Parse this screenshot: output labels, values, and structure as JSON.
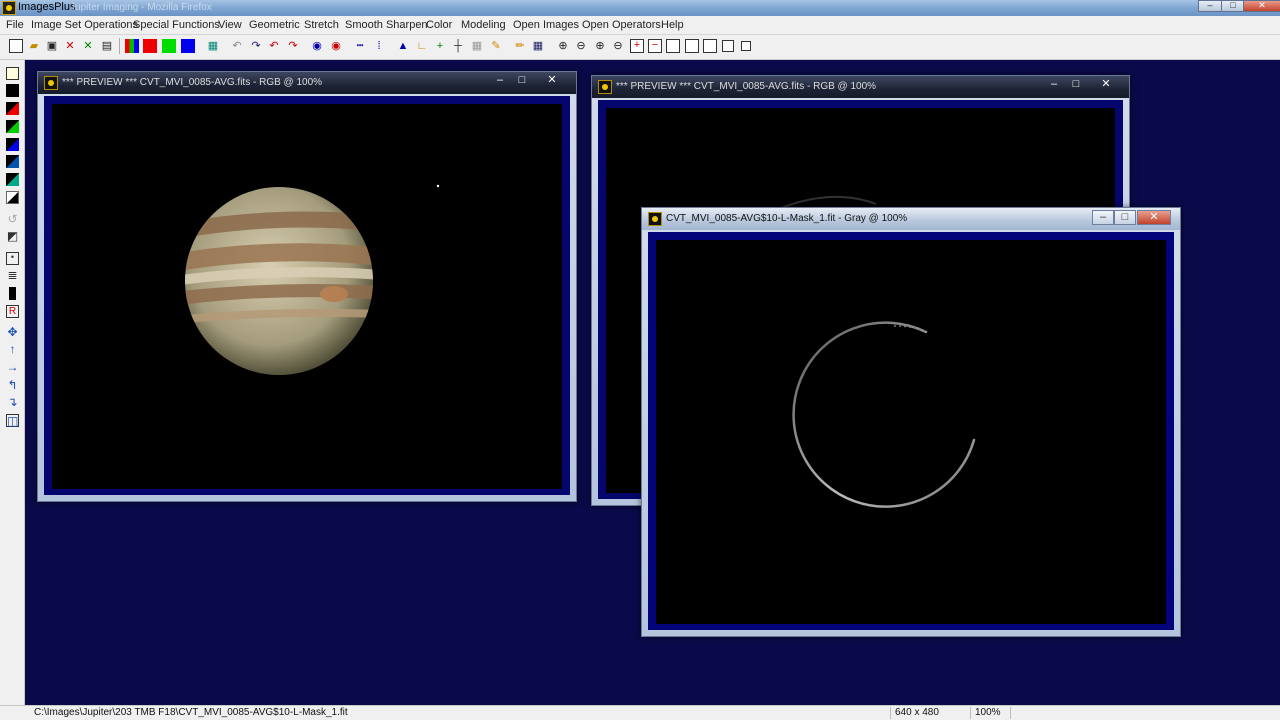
{
  "app": {
    "title": "ImagesPlus",
    "background_title": "Jupiter Imaging - Mozilla Firefox"
  },
  "menu": [
    "File",
    "Image Set Operations",
    "Special Functions",
    "View",
    "Geometric",
    "Stretch",
    "Smooth Sharpen",
    "Color",
    "Modeling",
    "Open Images",
    "Open Operators",
    "Help"
  ],
  "windows": {
    "preview1": {
      "title": "*** PREVIEW *** CVT_MVI_0085-AVG.fits - RGB @ 100%"
    },
    "preview2": {
      "title": "*** PREVIEW *** CVT_MVI_0085-AVG.fits - RGB @ 100%"
    },
    "mask": {
      "title": "CVT_MVI_0085-AVG$10-L-Mask_1.fit - Gray @ 100%"
    }
  },
  "status": {
    "path": "C:\\Images\\Jupiter\\203 TMB F18\\CVT_MVI_0085-AVG$10-L-Mask_1.fit",
    "dimensions": "640 x 480",
    "zoom": "100%"
  },
  "colors": {
    "desktop": "#0a0a4a",
    "image_frame": "#05056e"
  }
}
